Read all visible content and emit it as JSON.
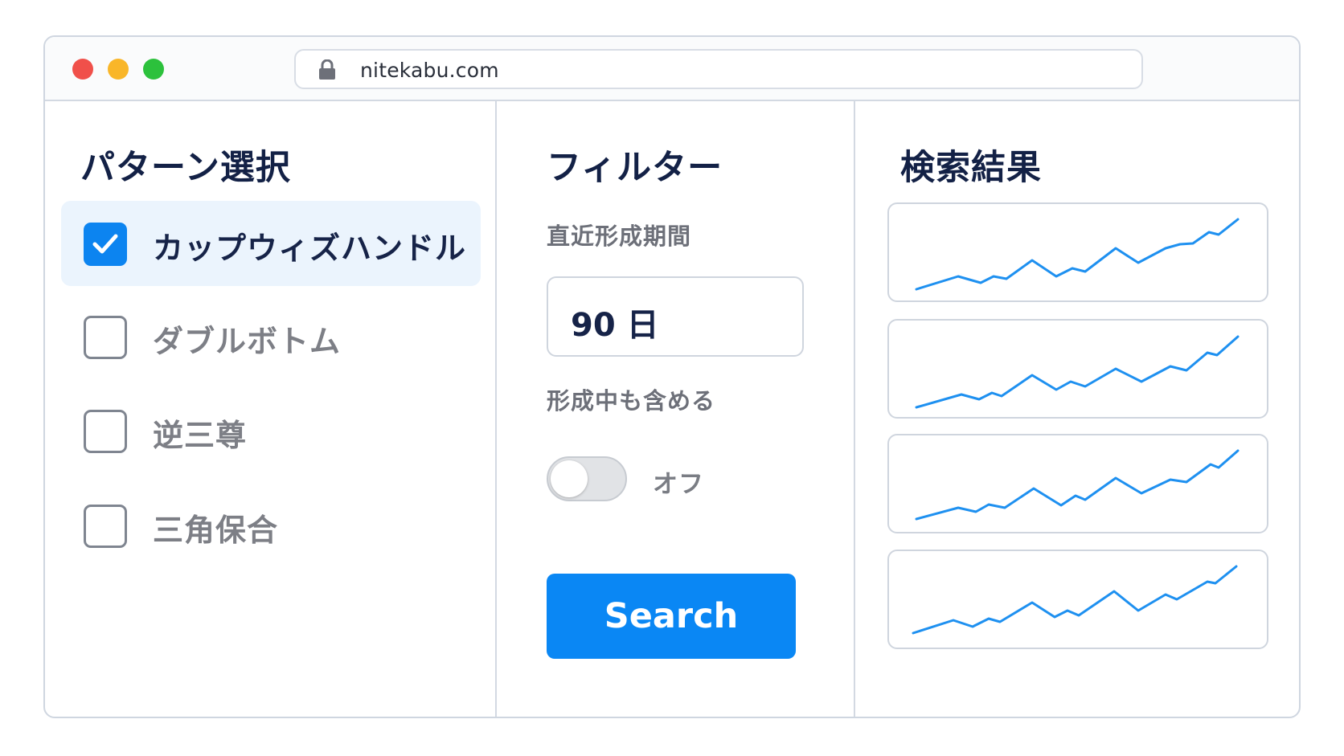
{
  "browser": {
    "url": "nitekabu.com"
  },
  "patterns": {
    "title": "パターン選択",
    "items": [
      {
        "label": "カップウィズハンドル",
        "checked": true
      },
      {
        "label": "ダブルボトム",
        "checked": false
      },
      {
        "label": "逆三尊",
        "checked": false
      },
      {
        "label": "三角保合",
        "checked": false
      }
    ]
  },
  "filter": {
    "title": "フィルター",
    "period_label": "直近形成期間",
    "period_value": "90 日",
    "forming_label": "形成中も含める",
    "forming_state": "オフ",
    "forming_enabled": false,
    "search_label": "Search"
  },
  "results": {
    "title": "検索結果",
    "line_color": "#1e90f0",
    "count": 4
  },
  "colors": {
    "accent": "#0a87f4",
    "title_text": "#132146",
    "muted_text": "#7d7f86"
  }
}
